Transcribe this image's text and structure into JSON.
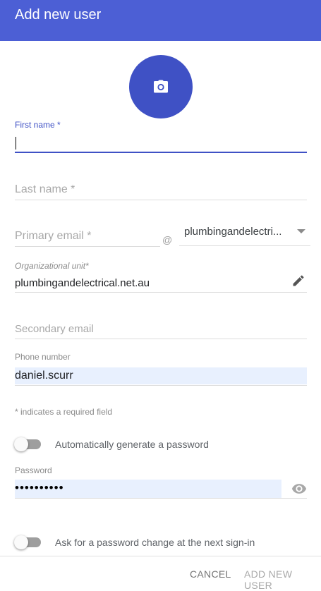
{
  "header": {
    "title": "Add new user"
  },
  "avatar": {
    "icon": "camera-icon"
  },
  "form": {
    "first_name": {
      "label": "First name *",
      "value": ""
    },
    "last_name": {
      "placeholder": "Last name *"
    },
    "primary_email": {
      "placeholder": "Primary email *",
      "at": "@",
      "domain": "plumbingandelectri..."
    },
    "org_unit": {
      "label": "Organizational unit*",
      "value": "plumbingandelectrical.net.au"
    },
    "secondary_email": {
      "placeholder": "Secondary email"
    },
    "phone": {
      "label": "Phone number",
      "value": "daniel.scurr"
    },
    "required_note": "* indicates a required field",
    "auto_password": {
      "label": "Automatically generate a password",
      "on": false
    },
    "password": {
      "label": "Password",
      "value": "••••••••••"
    },
    "change_password": {
      "label": "Ask for a password change at the next sign-in",
      "on": false
    }
  },
  "footer": {
    "cancel": "CANCEL",
    "add": "ADD NEW USER"
  },
  "colors": {
    "header": "#4c5fd5",
    "accent": "#3f51c5",
    "autofill": "#e8f0fe"
  }
}
